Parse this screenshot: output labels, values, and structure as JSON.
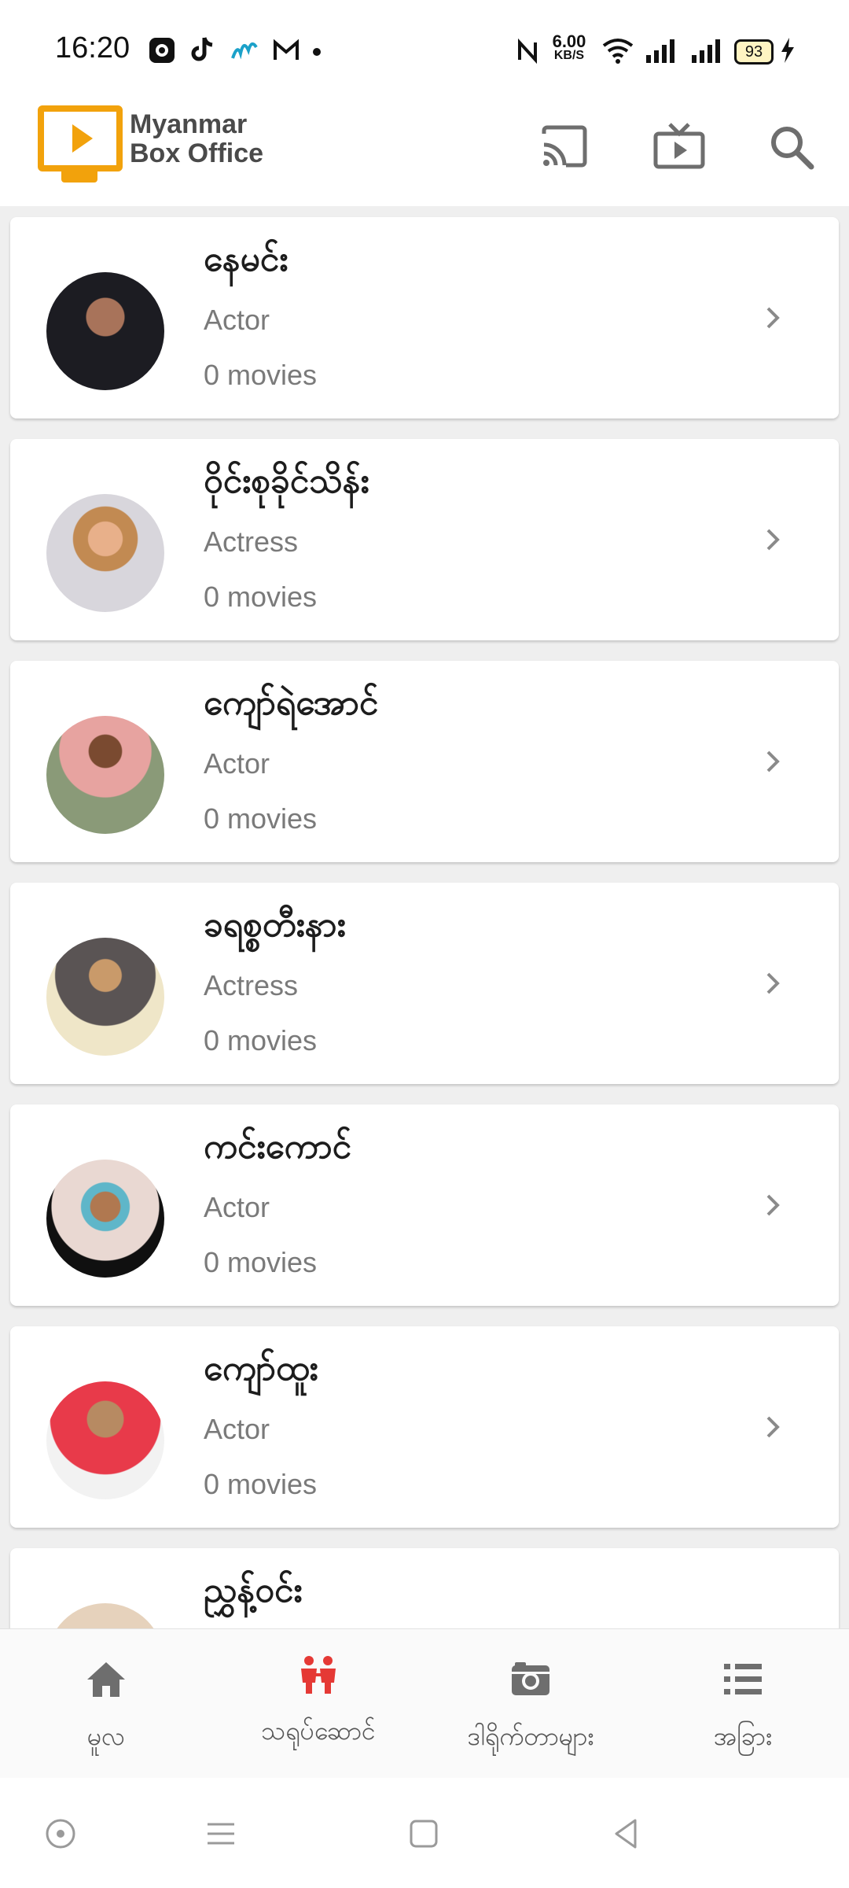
{
  "status_bar": {
    "time": "16:20",
    "net_speed_value": "6.00",
    "net_speed_unit": "KB/S",
    "battery": "93",
    "icons": [
      "screen-record-icon",
      "tiktok-icon",
      "messenger-icon",
      "gmail-icon",
      "dot-icon",
      "nfc-icon",
      "wifi-icon",
      "signal-icon",
      "signal-icon",
      "battery-icon",
      "charging-icon"
    ]
  },
  "header": {
    "logo_line1": "Myanmar",
    "logo_line2": "Box Office",
    "brand_color": "#f2a20c",
    "actions": [
      "cast-icon",
      "tv-icon",
      "search-icon"
    ]
  },
  "people": [
    {
      "name": "နေမင်း",
      "role": "Actor",
      "count": "0 movies"
    },
    {
      "name": "ဝိုင်းစုခိုင်သိန်း",
      "role": "Actress",
      "count": "0 movies"
    },
    {
      "name": "ကျော်ရဲအောင်",
      "role": "Actor",
      "count": "0 movies"
    },
    {
      "name": "ခရစ္စတီးနား",
      "role": "Actress",
      "count": "0 movies"
    },
    {
      "name": "ကင်းကောင်",
      "role": "Actor",
      "count": "0 movies"
    },
    {
      "name": "ကျော်ထူး",
      "role": "Actor",
      "count": "0 movies"
    },
    {
      "name": "ညွှန့်ဝင်း",
      "role": "",
      "count": ""
    }
  ],
  "bottom_nav": [
    {
      "label": "မူလ",
      "icon": "home-icon"
    },
    {
      "label": "သရုပ်ဆောင်",
      "icon": "people-icon",
      "active": true
    },
    {
      "label": "ဒါရိုက်တာများ",
      "icon": "camera-icon"
    },
    {
      "label": "အခြား",
      "icon": "list-icon"
    }
  ],
  "colors": {
    "active_nav": "#e53935",
    "inactive_icon": "#6e6e6e",
    "secondary_text": "#7a7a7a"
  }
}
